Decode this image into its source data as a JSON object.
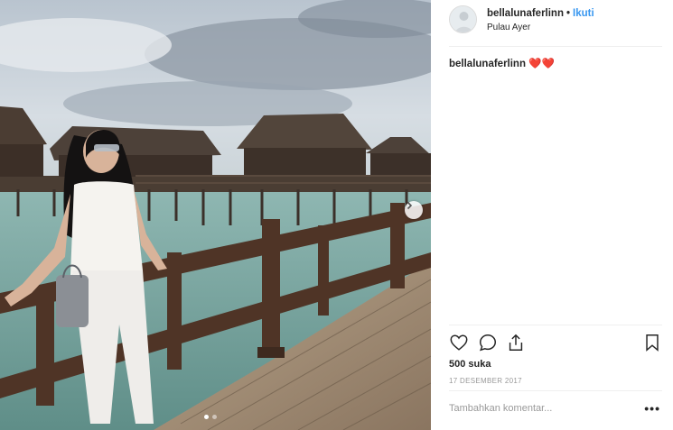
{
  "post": {
    "username": "bellalunaferlinn",
    "separator": "•",
    "follow_label": "Ikuti",
    "location": "Pulau Ayer",
    "caption_user": "bellalunaferlinn",
    "caption_text": "❤️❤️",
    "likes": "500 suka",
    "date": "17 DESEMBER 2017",
    "comment_placeholder": "Tambahkan komentar...",
    "more_label": "•••"
  },
  "carousel": {
    "total": 2,
    "active": 1
  },
  "icons": [
    "heart-icon",
    "comment-icon",
    "share-icon",
    "bookmark-icon",
    "chevron-right-icon"
  ],
  "colors": {
    "link": "#3897f0",
    "text": "#262626",
    "muted": "#999999",
    "divider": "#efefef"
  }
}
